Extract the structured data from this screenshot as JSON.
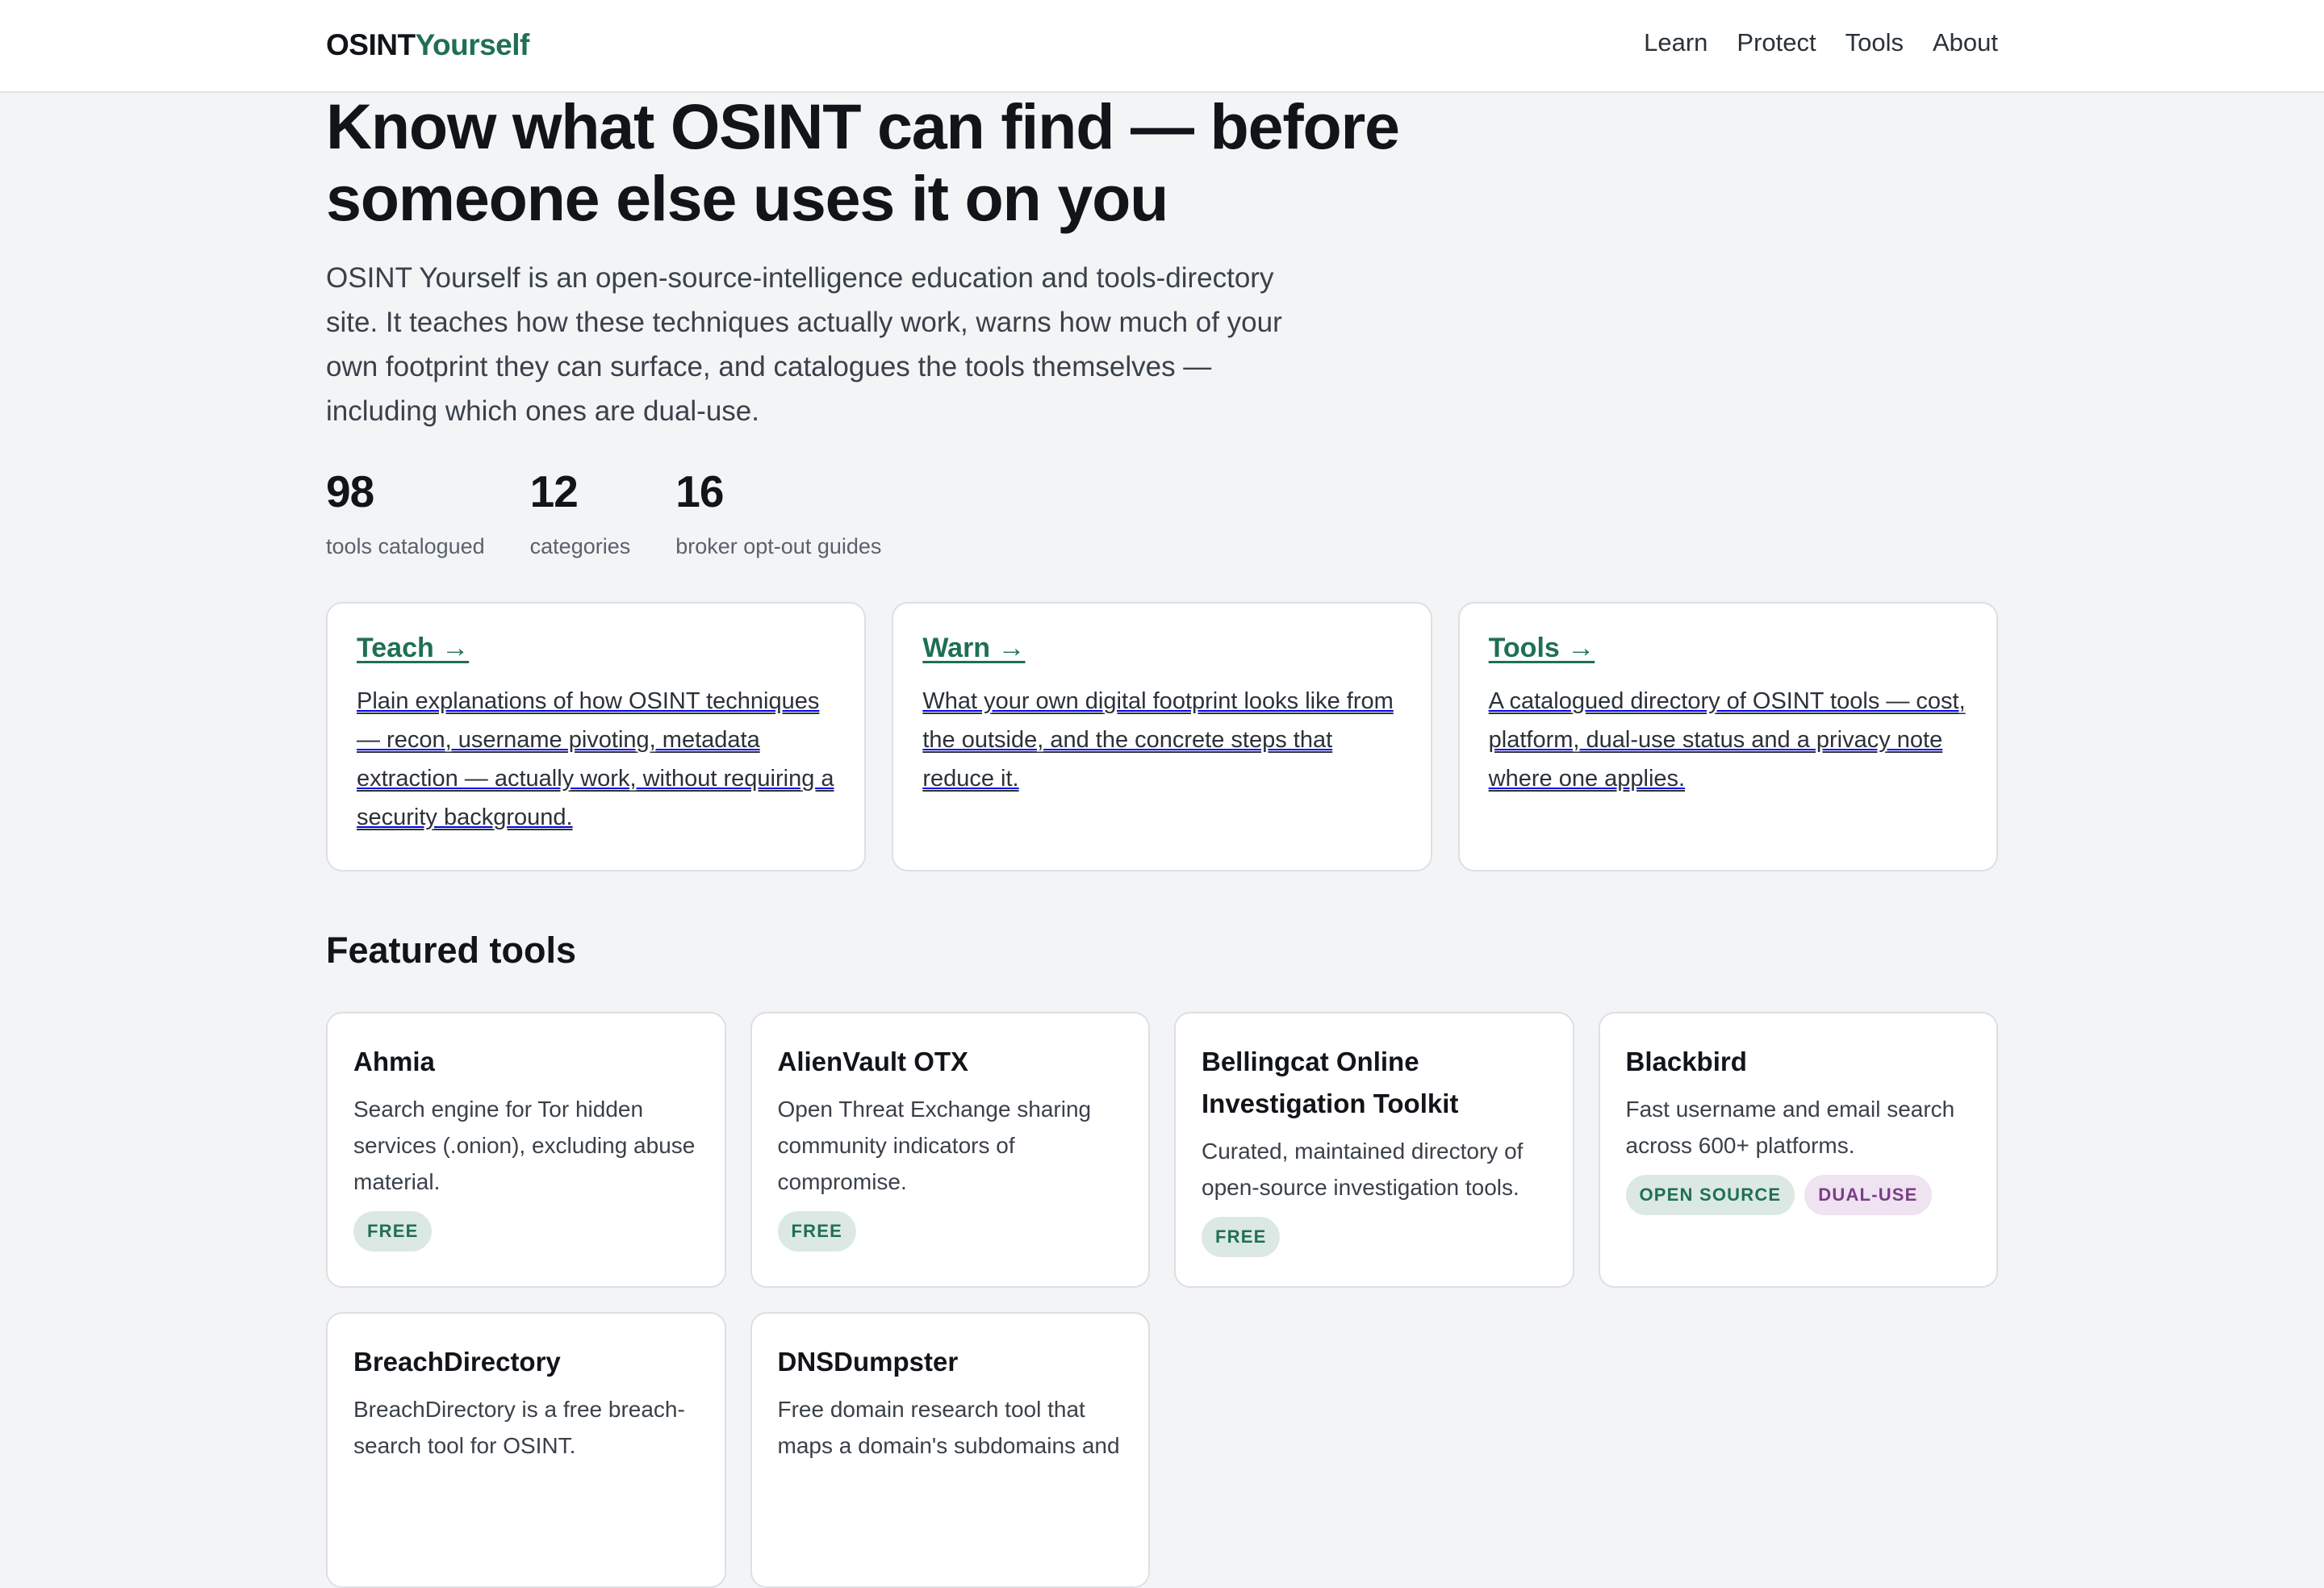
{
  "brand": {
    "part1": "OSINT",
    "part2": "Yourself"
  },
  "nav": [
    "Learn",
    "Protect",
    "Tools",
    "About"
  ],
  "hero": {
    "title": "Know what OSINT can find — before someone else uses it on you",
    "lead": "OSINT Yourself is an open-source-intelligence education and tools-directory site. It teaches how these techniques actually work, warns how much of your own footprint they can surface, and catalogues the tools themselves — including which ones are dual-use."
  },
  "stats": [
    {
      "value": "98",
      "label": "tools catalogued"
    },
    {
      "value": "12",
      "label": "categories"
    },
    {
      "value": "16",
      "label": "broker opt-out guides"
    }
  ],
  "pillars": [
    {
      "title": "Teach →",
      "desc": "Plain explanations of how OSINT techniques — recon, username pivoting, metadata extraction — actually work, without requiring a security background."
    },
    {
      "title": "Warn →",
      "desc": "What your own digital footprint looks like from the outside, and the concrete steps that reduce it."
    },
    {
      "title": "Tools →",
      "desc": "A catalogued directory of OSINT tools — cost, platform, dual-use status and a privacy note where one applies."
    }
  ],
  "featured": {
    "title": "Featured tools",
    "tools": [
      {
        "name": "Ahmia",
        "desc": "Search engine for Tor hidden services (.onion), excluding abuse material.",
        "badges": [
          "FREE"
        ]
      },
      {
        "name": "AlienVault OTX",
        "desc": "Open Threat Exchange sharing community indicators of compromise.",
        "badges": [
          "FREE"
        ]
      },
      {
        "name": "Bellingcat Online Investigation Toolkit",
        "desc": "Curated, maintained directory of open-source investigation tools.",
        "badges": [
          "FREE"
        ]
      },
      {
        "name": "Blackbird",
        "desc": "Fast username and email search across 600+ platforms.",
        "badges": [
          "OPEN SOURCE",
          "DUAL-USE"
        ]
      },
      {
        "name": "BreachDirectory",
        "desc": "BreachDirectory is a free breach-search tool for OSINT.",
        "badges": []
      },
      {
        "name": "DNSDumpster",
        "desc": "Free domain research tool that maps a domain's subdomains and",
        "badges": []
      }
    ]
  }
}
